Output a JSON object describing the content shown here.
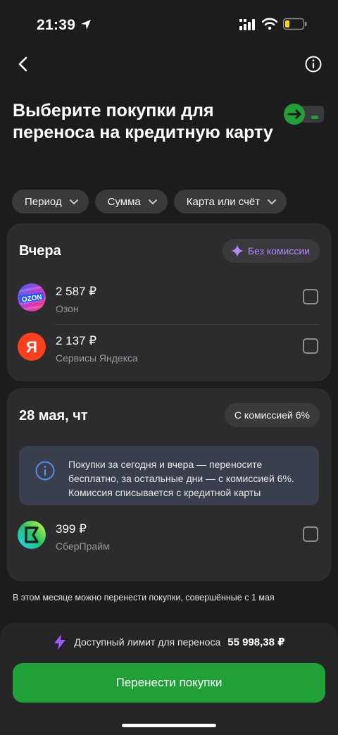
{
  "status_bar": {
    "time": "21:39",
    "icons": [
      "location-arrow-icon",
      "cellular-signal-icon",
      "wifi-icon",
      "battery-icon"
    ]
  },
  "nav": {
    "back_icon": "chevron-left-icon",
    "info_icon": "info-circle-icon"
  },
  "title": "Выберите покупки для переноса на кредитную карту",
  "filters": [
    {
      "label": "Период"
    },
    {
      "label": "Сумма"
    },
    {
      "label": "Карта или счёт"
    }
  ],
  "groups": [
    {
      "date": "Вчера",
      "badge": "Без комиссии",
      "items": [
        {
          "amount": "2 587 ₽",
          "merchant": "Озон",
          "logo": "ozon-logo"
        },
        {
          "amount": "2 137 ₽",
          "merchant": "Сервисы Яндекса",
          "logo": "yandex-logo"
        }
      ]
    },
    {
      "date": "28 мая, чт",
      "badge": "С комиссией 6%",
      "notice": "Покупки за сегодня и вчера — переносите бесплатно, за остальные дни — с комиссией 6%. Комиссия списывается с кредитной карты",
      "items": [
        {
          "amount": "399 ₽",
          "merchant": "СберПрайм",
          "logo": "sberprime-logo"
        }
      ]
    }
  ],
  "footnote": "В этом месяце можно перенести покупки, совершённые с 1 мая",
  "limit": {
    "label": "Доступный лимит для переноса",
    "value": "55 998,38 ₽"
  },
  "cta_label": "Перенести покупки",
  "colors": {
    "background": "#1c1c1e",
    "card": "#2c2c2e",
    "accent_green": "#21a038",
    "accent_purple": "#b388ff"
  }
}
